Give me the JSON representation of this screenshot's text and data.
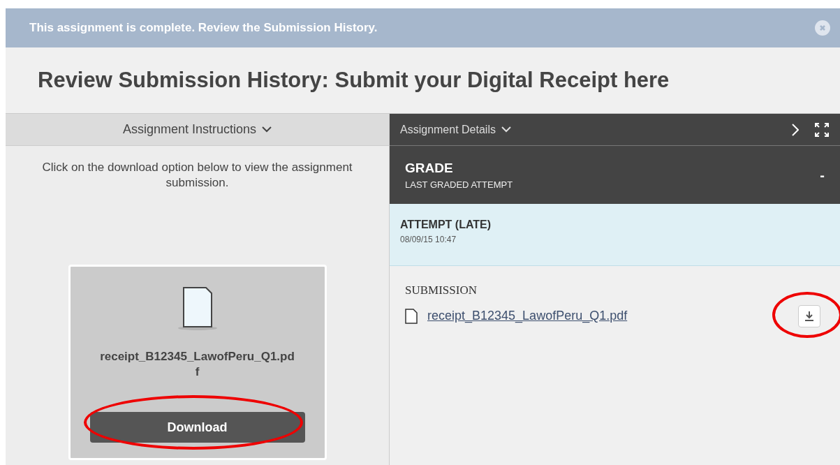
{
  "banner": {
    "message": "This assignment is complete. Review the Submission History."
  },
  "title": "Review Submission History: Submit your Digital Receipt here",
  "left_panel": {
    "header": "Assignment Instructions",
    "instructions": "Click on the download option below to view the assignment submission.",
    "file": {
      "name": "receipt_B12345_LawofPeru_Q1.pdf",
      "button": "Download"
    }
  },
  "right_panel": {
    "header": "Assignment Details",
    "grade": {
      "title": "GRADE",
      "subtitle": "LAST GRADED ATTEMPT",
      "value": "-"
    },
    "attempt": {
      "title": "ATTEMPT (LATE)",
      "date": "08/09/15 10:47"
    },
    "submission": {
      "label": "SUBMISSION",
      "file": "receipt_B12345_LawofPeru_Q1.pdf"
    }
  }
}
